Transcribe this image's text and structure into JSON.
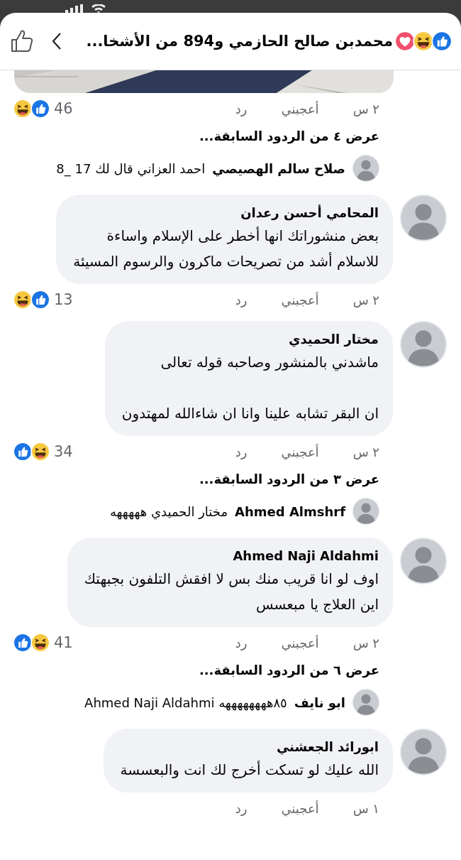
{
  "header": {
    "title": "محمدبن صالح الحازمي و894 من الأشخا...",
    "reactions": [
      {
        "kind": "like"
      },
      {
        "kind": "haha"
      },
      {
        "kind": "love"
      }
    ]
  },
  "items": [
    {
      "kind": "post_tail",
      "meta": {
        "time": "٢ س",
        "like": "أعجبني",
        "reply": "رد",
        "count": "46",
        "reactions": [
          {
            "kind": "haha"
          },
          {
            "kind": "like"
          }
        ]
      }
    },
    {
      "kind": "view_more",
      "text": "عرض ٤ من الردود السابقة..."
    },
    {
      "kind": "reply_preview",
      "name": "صلاح سالم الهصيصي",
      "text": "احمد العزاني قال لك 17 _8"
    },
    {
      "kind": "comment",
      "name": "المحامي أحسن رعدان",
      "text": "بعض منشوراتك انها أخطر على الإسلام واساءة\nللاسلام أشد من تصريحات ماكرون والرسوم المسيئة",
      "meta": {
        "time": "٢ س",
        "like": "أعجبني",
        "reply": "رد",
        "count": "13",
        "reactions": [
          {
            "kind": "haha"
          },
          {
            "kind": "like"
          }
        ]
      }
    },
    {
      "kind": "comment",
      "name": "مختار الحميدي",
      "text": "ماشدني بالمنشور وصاحبه قوله تعالى\n\nان البقر تشابه علينا وانا ان شاءالله لمهتدون",
      "meta": {
        "time": "٢ س",
        "like": "أعجبني",
        "reply": "رد",
        "count": "34",
        "reactions": [
          {
            "kind": "like"
          },
          {
            "kind": "haha"
          }
        ]
      }
    },
    {
      "kind": "view_more",
      "text": "عرض ٣ من الردود السابقة..."
    },
    {
      "kind": "reply_preview",
      "name": "Ahmed Almshrf",
      "text": "مختار الحميدي هههههه"
    },
    {
      "kind": "comment",
      "name": "Ahmed Naji Aldahmi",
      "text": "اوف لو انا قريب منك بس لا افقش التلفون بجبهتك\nاين العلاج يا مبعسس",
      "meta": {
        "time": "٢ س",
        "like": "أعجبني",
        "reply": "رد",
        "count": "41",
        "reactions": [
          {
            "kind": "like"
          },
          {
            "kind": "haha"
          }
        ]
      }
    },
    {
      "kind": "view_more",
      "text": "عرض ٦ من الردود السابقة..."
    },
    {
      "kind": "reply_preview",
      "name": "ابو نايف",
      "text": "٨٥ههههههههه Ahmed Naji Aldahmi"
    },
    {
      "kind": "comment",
      "name": "ابورائد الجعشني",
      "text": "الله عليك  لو تسكت أخرج لك انت والبعسسة",
      "meta": {
        "time": "١ س",
        "like": "أعجبني",
        "reply": "رد"
      }
    }
  ]
}
